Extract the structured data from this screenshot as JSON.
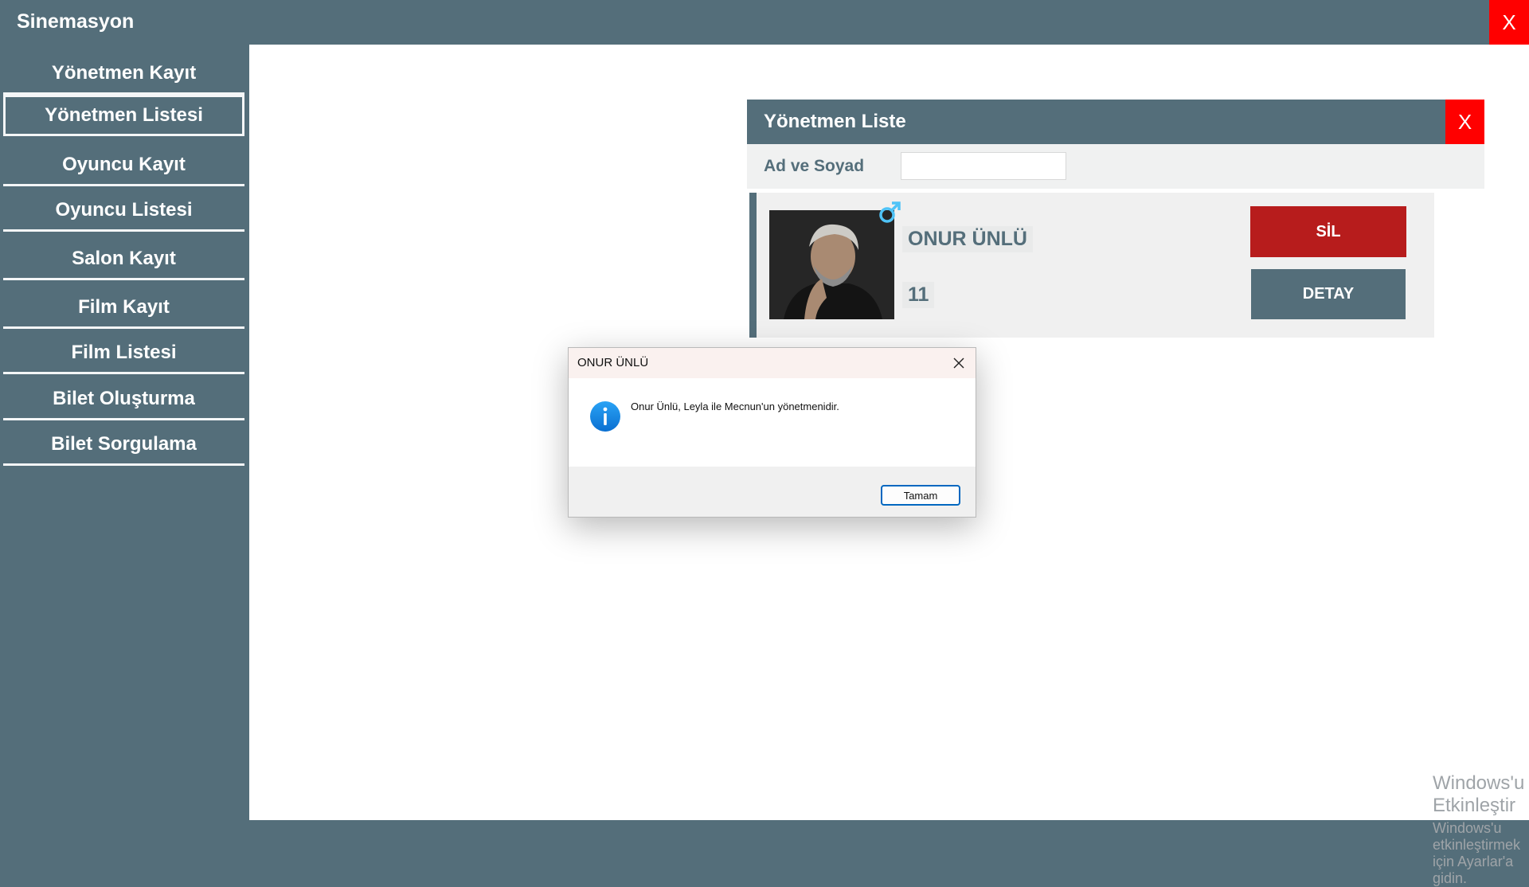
{
  "app": {
    "title": "Sinemasyon",
    "close_label": "X"
  },
  "sidebar": {
    "items": [
      {
        "label": "Yönetmen Kayıt"
      },
      {
        "label": "Yönetmen Listesi",
        "active": true
      },
      {
        "label": "Oyuncu Kayıt"
      },
      {
        "label": "Oyuncu Listesi"
      },
      {
        "label": "Salon Kayıt"
      },
      {
        "label": "Film Kayıt"
      },
      {
        "label": "Film Listesi"
      },
      {
        "label": "Bilet Oluşturma"
      },
      {
        "label": "Bilet Sorgulama"
      }
    ]
  },
  "director_list": {
    "title": "Yönetmen Liste",
    "close_label": "X",
    "filter": {
      "label": "Ad ve Soyad",
      "value": ""
    },
    "cards": [
      {
        "name": "ONUR  ÜNLÜ",
        "number": "11",
        "gender_icon": "male-symbol-icon",
        "photo": "director-photo",
        "delete_label": "SİL",
        "detail_label": "DETAY"
      }
    ]
  },
  "dialog": {
    "title": "ONUR  ÜNLÜ",
    "message": "Onur Ünlü, Leyla ile Mecnun'un yönetmenidir.",
    "icon": "info-icon",
    "ok_label": "Tamam"
  },
  "watermark": {
    "title": "Windows'u Etkinleştir",
    "subtitle": "Windows'u etkinleştirmek için Ayarlar'a gidin."
  },
  "colors": {
    "sidebar_bg": "#546e7a",
    "close_red": "#ff0000",
    "delete_red": "#b71c1c",
    "accent_blue": "#0067c0"
  }
}
